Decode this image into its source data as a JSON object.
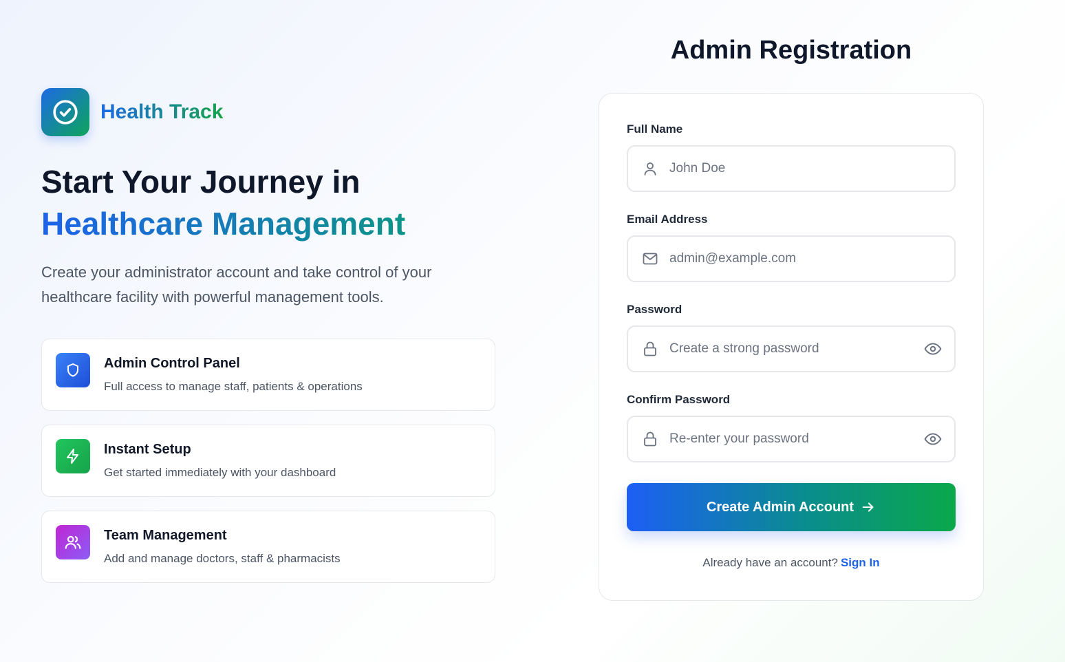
{
  "brand": {
    "name": "Health Track",
    "logo_icon": "check-circle-icon"
  },
  "hero": {
    "title_line1": "Start Your Journey in",
    "title_line2": "Healthcare Management",
    "description": "Create your administrator account and take control of your healthcare facility with powerful management tools."
  },
  "features": [
    {
      "icon": "shield-icon",
      "color": "#2563eb",
      "title": "Admin Control Panel",
      "description": "Full access to manage staff, patients & operations"
    },
    {
      "icon": "lightning-icon",
      "color": "#16a34a",
      "title": "Instant Setup",
      "description": "Get started immediately with your dashboard"
    },
    {
      "icon": "users-icon",
      "color": "#a855f7",
      "title": "Team Management",
      "description": "Add and manage doctors, staff & pharmacists"
    }
  ],
  "form": {
    "heading": "Admin Registration",
    "fields": {
      "full_name": {
        "label": "Full Name",
        "placeholder": "John Doe",
        "value": "",
        "icon": "user-icon"
      },
      "email": {
        "label": "Email Address",
        "placeholder": "admin@example.com",
        "value": "",
        "icon": "mail-icon"
      },
      "password": {
        "label": "Password",
        "placeholder": "Create a strong password",
        "value": "",
        "icon": "lock-icon",
        "toggle_icon": "eye-icon"
      },
      "confirm_password": {
        "label": "Confirm Password",
        "placeholder": "Re-enter your password",
        "value": "",
        "icon": "lock-icon",
        "toggle_icon": "eye-icon"
      }
    },
    "submit_label": "Create Admin Account",
    "signin_prompt": "Already have an account?",
    "signin_link": "Sign In"
  },
  "colors": {
    "primary_blue": "#1d63e9",
    "primary_green": "#16a34a",
    "text_dark": "#0f172a"
  }
}
